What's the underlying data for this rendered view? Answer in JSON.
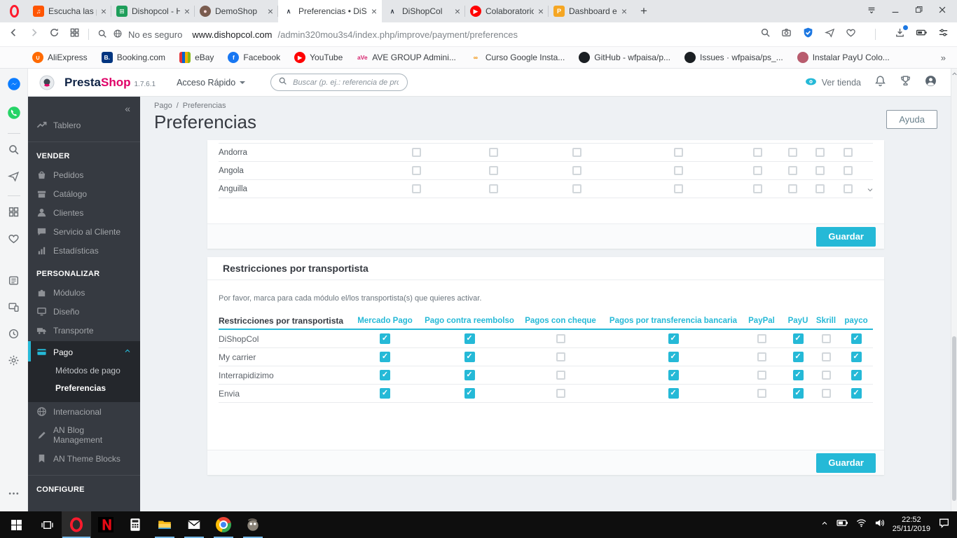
{
  "colors": {
    "accent": "#25b9d7",
    "brand_pink": "#df0067"
  },
  "browser": {
    "tabs": [
      {
        "title": "Escucha las pistas q...",
        "icon": "soundcloud"
      },
      {
        "title": "Dishopcol - Hojas d...",
        "icon": "sheets"
      },
      {
        "title": "DemoShop",
        "icon": "shop"
      },
      {
        "title": "Preferencias • DiSh...",
        "icon": "prestashop",
        "active": true
      },
      {
        "title": "DiShopCol",
        "icon": "prestashop"
      },
      {
        "title": "Colaboratorio ePay...",
        "icon": "youtube"
      },
      {
        "title": "Dashboard ePayco",
        "icon": "epayco"
      }
    ],
    "tab_close_glyph": "×",
    "new_tab_glyph": "+",
    "address": {
      "security": "No es seguro",
      "host": "www.dishopcol.com",
      "path": "/admin320mou3s4/index.php/improve/payment/preferences"
    },
    "bookmarks": [
      {
        "icon": "aliexpress",
        "label": "AliExpress"
      },
      {
        "icon": "booking",
        "label": "Booking.com"
      },
      {
        "icon": "ebay",
        "label": "eBay"
      },
      {
        "icon": "facebook",
        "label": "Facebook"
      },
      {
        "icon": "youtube",
        "label": "YouTube"
      },
      {
        "icon": "ave",
        "label": "AVE GROUP Admini..."
      },
      {
        "icon": "curso",
        "label": "Curso Google Insta..."
      },
      {
        "icon": "github",
        "label": "GitHub - wfpaisa/p..."
      },
      {
        "icon": "github",
        "label": "Issues · wfpaisa/ps_..."
      },
      {
        "icon": "payu",
        "label": "Instalar PayU Colo..."
      }
    ],
    "bookmarks_overflow": "»"
  },
  "ps_header": {
    "brand_a": "Presta",
    "brand_b": "Shop",
    "version": "1.7.6.1",
    "quick_access": "Acceso Rápido",
    "search_placeholder": "Buscar (p. ej.: referencia de producto, n...",
    "view_store": "Ver tienda"
  },
  "sidebar": {
    "collapse_glyph": "«",
    "sections": [
      {
        "items": [
          {
            "icon": "trend",
            "label": "Tablero"
          }
        ]
      },
      {
        "divider": true,
        "title": "VENDER",
        "items": [
          {
            "icon": "basket",
            "label": "Pedidos"
          },
          {
            "icon": "store",
            "label": "Catálogo"
          },
          {
            "icon": "person",
            "label": "Clientes"
          },
          {
            "icon": "chat",
            "label": "Servicio al Cliente"
          },
          {
            "icon": "chart",
            "label": "Estadísticas"
          }
        ]
      },
      {
        "title": "PERSONALIZAR",
        "items": [
          {
            "icon": "puzzle",
            "label": "Módulos"
          },
          {
            "icon": "monitor",
            "label": "Diseño"
          },
          {
            "icon": "truck",
            "label": "Transporte"
          },
          {
            "icon": "card",
            "label": "Pago",
            "active": true,
            "children": [
              {
                "label": "Métodos de pago"
              },
              {
                "label": "Preferencias",
                "current": true
              }
            ]
          },
          {
            "icon": "globe",
            "label": "Internacional"
          },
          {
            "icon": "pencil",
            "label": "AN Blog Management"
          },
          {
            "icon": "bookmark",
            "label": "AN Theme Blocks"
          }
        ]
      },
      {
        "divider": true,
        "title": "CONFIGURE",
        "items": []
      }
    ]
  },
  "page": {
    "breadcrumb": [
      "Pago",
      "Preferencias"
    ],
    "breadcrumb_sep": "/",
    "title": "Preferencias",
    "help": "Ayuda"
  },
  "country_table": {
    "rows": [
      {
        "name": "Andorra",
        "checks": [
          false,
          false,
          false,
          false,
          false,
          false,
          false,
          false
        ]
      },
      {
        "name": "Angola",
        "checks": [
          false,
          false,
          false,
          false,
          false,
          false,
          false,
          false
        ]
      },
      {
        "name": "Anguilla",
        "checks": [
          false,
          false,
          false,
          false,
          false,
          false,
          false,
          false
        ]
      }
    ],
    "save": "Guardar"
  },
  "carrier": {
    "title": "Restricciones por transportista",
    "hint": "Por favor, marca para cada módulo el/los transportista(s) que quieres activar.",
    "first_column": "Restricciones por transportista",
    "columns": [
      "Mercado Pago",
      "Pago contra reembolso",
      "Pagos con cheque",
      "Pagos por transferencia bancaria",
      "PayPal",
      "PayU",
      "Skrill",
      "payco"
    ],
    "check_glyph": "✓",
    "rows": [
      {
        "name": "DiShopCol",
        "checks": [
          true,
          true,
          false,
          true,
          false,
          true,
          false,
          true
        ]
      },
      {
        "name": "My carrier",
        "checks": [
          true,
          true,
          false,
          true,
          false,
          true,
          false,
          true
        ]
      },
      {
        "name": "Interrapidizimo",
        "checks": [
          true,
          true,
          false,
          true,
          false,
          true,
          false,
          true
        ]
      },
      {
        "name": "Envia",
        "checks": [
          true,
          true,
          false,
          true,
          false,
          true,
          false,
          true
        ]
      }
    ],
    "save": "Guardar"
  },
  "opera_sidebar": [
    "messenger",
    "whatsapp",
    "divider",
    "search",
    "send",
    "divider",
    "speed-dial",
    "heart",
    "news",
    "flow",
    "history",
    "settings",
    "ellipsis"
  ],
  "taskbar": {
    "apps": [
      {
        "name": "start"
      },
      {
        "name": "task-view"
      },
      {
        "name": "opera",
        "active": true,
        "running": true
      },
      {
        "name": "netflix"
      },
      {
        "name": "calculator"
      },
      {
        "name": "explorer",
        "running": true
      },
      {
        "name": "mail",
        "running": true
      },
      {
        "name": "chrome",
        "running": true
      },
      {
        "name": "gimp",
        "running": true
      }
    ],
    "tray": {
      "time": "22:52",
      "date": "25/11/2019"
    }
  }
}
